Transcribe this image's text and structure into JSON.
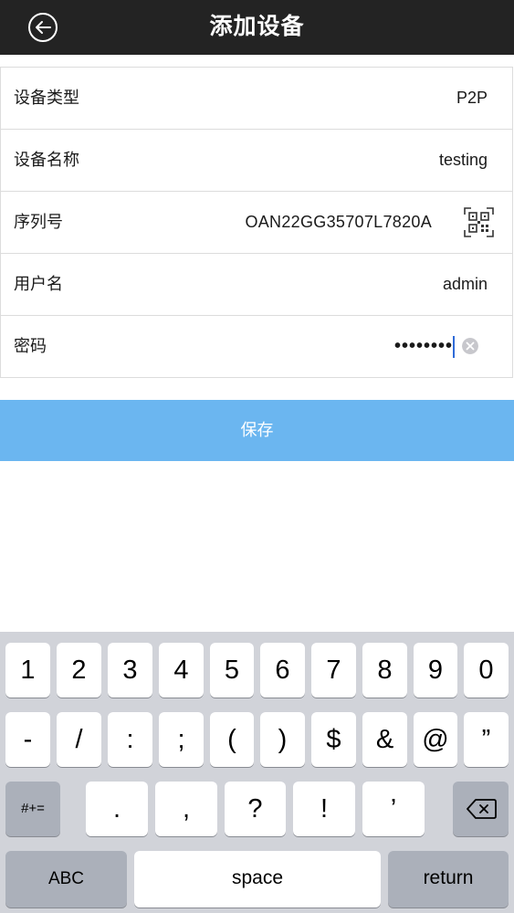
{
  "header": {
    "title": "添加设备"
  },
  "form": {
    "rows": [
      {
        "label": "设备类型",
        "value": "P2P"
      },
      {
        "label": "设备名称",
        "value": "testing"
      },
      {
        "label": "序列号",
        "value": "OAN22GG35707L7820A"
      },
      {
        "label": "用户名",
        "value": "admin"
      },
      {
        "label": "密码",
        "value": "••••••••"
      }
    ]
  },
  "save_label": "保存",
  "keyboard": {
    "row1": [
      "1",
      "2",
      "3",
      "4",
      "5",
      "6",
      "7",
      "8",
      "9",
      "0"
    ],
    "row2": [
      "-",
      "/",
      ":",
      ";",
      "(",
      ")",
      "$",
      "&",
      "@",
      "”"
    ],
    "row3": [
      "#+=",
      ".",
      ",",
      "?",
      "!",
      "’"
    ],
    "row4": {
      "abc": "ABC",
      "space": "space",
      "return": "return"
    }
  },
  "colors": {
    "header_bg": "#232323",
    "save_bg": "#6bb6f0",
    "keyboard_bg": "#d1d3d9",
    "cursor": "#2f6bd8"
  }
}
